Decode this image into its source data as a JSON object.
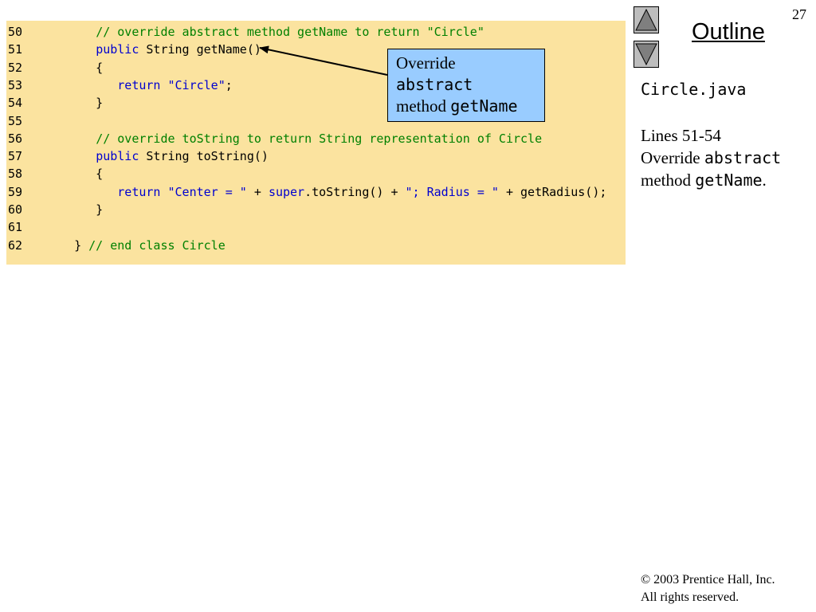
{
  "slide": {
    "number": "27"
  },
  "outline": {
    "title": "Outline"
  },
  "nav": {
    "up_icon": "up-triangle-icon",
    "down_icon": "down-triangle-icon"
  },
  "sidebar": {
    "file_name": "Circle.java",
    "lines_label": "Lines 51-54",
    "desc_override": "Override ",
    "desc_abstract": "abstract",
    "desc_method": "method ",
    "desc_getname": "getName",
    "desc_period": "."
  },
  "callout": {
    "line1": "Override",
    "line2": "abstract",
    "line3_prefix": "method ",
    "line3_mono": "getName"
  },
  "code": {
    "lines": [
      {
        "num": "50",
        "tokens": [
          {
            "t": "      ",
            "c": "normal"
          },
          {
            "t": "// override abstract method getName to return \"Circle\"",
            "c": "comment"
          }
        ]
      },
      {
        "num": "51",
        "tokens": [
          {
            "t": "      ",
            "c": "normal"
          },
          {
            "t": "public",
            "c": "keyword"
          },
          {
            "t": " String getName()",
            "c": "normal"
          }
        ]
      },
      {
        "num": "52",
        "tokens": [
          {
            "t": "      {",
            "c": "normal"
          }
        ]
      },
      {
        "num": "53",
        "tokens": [
          {
            "t": "         ",
            "c": "normal"
          },
          {
            "t": "return",
            "c": "keyword"
          },
          {
            "t": " ",
            "c": "normal"
          },
          {
            "t": "\"Circle\"",
            "c": "string"
          },
          {
            "t": ";",
            "c": "normal"
          }
        ]
      },
      {
        "num": "54",
        "tokens": [
          {
            "t": "      }",
            "c": "normal"
          }
        ]
      },
      {
        "num": "55",
        "tokens": []
      },
      {
        "num": "56",
        "tokens": [
          {
            "t": "      ",
            "c": "normal"
          },
          {
            "t": "// override toString to return String representation of Circle",
            "c": "comment"
          }
        ]
      },
      {
        "num": "57",
        "tokens": [
          {
            "t": "      ",
            "c": "normal"
          },
          {
            "t": "public",
            "c": "keyword"
          },
          {
            "t": " String toString()",
            "c": "normal"
          }
        ]
      },
      {
        "num": "58",
        "tokens": [
          {
            "t": "      {",
            "c": "normal"
          }
        ]
      },
      {
        "num": "59",
        "tokens": [
          {
            "t": "         ",
            "c": "normal"
          },
          {
            "t": "return",
            "c": "keyword"
          },
          {
            "t": " ",
            "c": "normal"
          },
          {
            "t": "\"Center = \"",
            "c": "string"
          },
          {
            "t": " + ",
            "c": "normal"
          },
          {
            "t": "super",
            "c": "keyword"
          },
          {
            "t": ".toString() + ",
            "c": "normal"
          },
          {
            "t": "\"; Radius = \"",
            "c": "string"
          },
          {
            "t": " + getRadius();",
            "c": "normal"
          }
        ]
      },
      {
        "num": "60",
        "tokens": [
          {
            "t": "      }",
            "c": "normal"
          }
        ]
      },
      {
        "num": "61",
        "tokens": []
      },
      {
        "num": "62",
        "tokens": [
          {
            "t": "   } ",
            "c": "normal"
          },
          {
            "t": "// end class Circle",
            "c": "comment"
          }
        ]
      }
    ]
  },
  "footer": {
    "copyright_line1": "© 2003 Prentice Hall, Inc.",
    "copyright_line2": "All rights reserved."
  }
}
